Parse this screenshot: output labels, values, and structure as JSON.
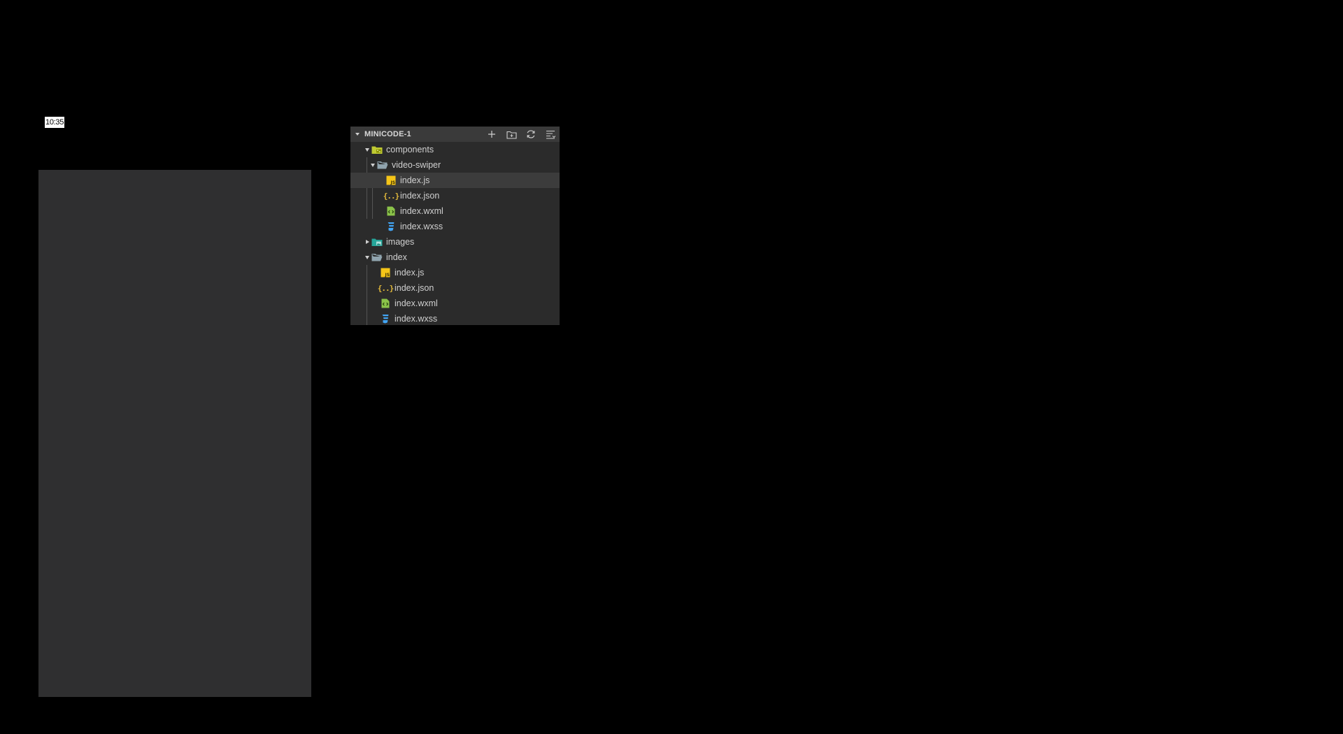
{
  "clock": {
    "time": "10:35"
  },
  "explorer": {
    "title": "MINICODE-1",
    "actions": [
      {
        "icon": "plus-icon"
      },
      {
        "icon": "new-folder-icon"
      },
      {
        "icon": "refresh-icon"
      },
      {
        "icon": "collapse-all-icon"
      }
    ],
    "tree": [
      {
        "label": "components",
        "type": "folder",
        "expanded": true,
        "depth": 0,
        "icon": "components-folder-icon"
      },
      {
        "label": "video-swiper",
        "type": "folder",
        "expanded": true,
        "depth": 1,
        "icon": "folder-open-icon"
      },
      {
        "label": "index.js",
        "type": "file",
        "depth": 2,
        "icon": "js-file-icon",
        "selected": true
      },
      {
        "label": "index.json",
        "type": "file",
        "depth": 2,
        "icon": "json-file-icon"
      },
      {
        "label": "index.wxml",
        "type": "file",
        "depth": 2,
        "icon": "wxml-file-icon"
      },
      {
        "label": "index.wxss",
        "type": "file",
        "depth": 2,
        "icon": "wxss-file-icon"
      },
      {
        "label": "images",
        "type": "folder",
        "expanded": false,
        "depth": 0,
        "icon": "images-folder-icon"
      },
      {
        "label": "index",
        "type": "folder",
        "expanded": true,
        "depth": 0,
        "icon": "folder-open-icon"
      },
      {
        "label": "index.js",
        "type": "file",
        "depth": 1,
        "icon": "js-file-icon"
      },
      {
        "label": "index.json",
        "type": "file",
        "depth": 1,
        "icon": "json-file-icon"
      },
      {
        "label": "index.wxml",
        "type": "file",
        "depth": 1,
        "icon": "wxml-file-icon"
      },
      {
        "label": "index.wxss",
        "type": "file",
        "depth": 1,
        "icon": "wxss-file-icon"
      }
    ]
  },
  "colors": {
    "background": "#000000",
    "panel": "#2b2b2b",
    "header": "#3a3a3a",
    "selected": "#3c3c3c",
    "js": "#f5c518",
    "json": "#e2b93b",
    "wxml": "#8bc34a",
    "wxss": "#42a5f5"
  }
}
